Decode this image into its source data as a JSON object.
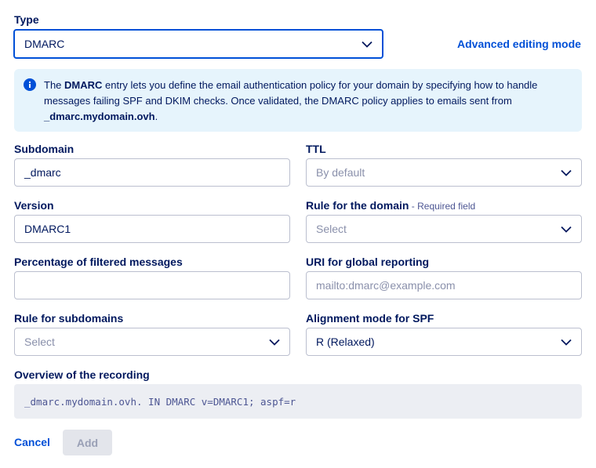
{
  "type": {
    "label": "Type",
    "value": "DMARC"
  },
  "advanced_link": "Advanced editing mode",
  "info": {
    "p1": "The ",
    "bold1": "DMARC",
    "p2": " entry lets you define the email authentication policy for your domain by specifying how to handle messages failing SPF and DKIM checks. Once validated, the DMARC policy applies to emails sent from ",
    "bold2": "_dmarc.mydomain.ovh",
    "p3": "."
  },
  "subdomain": {
    "label": "Subdomain",
    "value": "_dmarc"
  },
  "ttl": {
    "label": "TTL",
    "placeholder": "By default"
  },
  "version": {
    "label": "Version",
    "value": "DMARC1"
  },
  "rule_domain": {
    "label": "Rule for the domain",
    "hint": " - Required field",
    "placeholder": "Select"
  },
  "percentage": {
    "label": "Percentage of filtered messages",
    "value": ""
  },
  "uri_global": {
    "label": "URI for global reporting",
    "placeholder": "mailto:dmarc@example.com"
  },
  "rule_subdomains": {
    "label": "Rule for subdomains",
    "placeholder": "Select"
  },
  "alignment_spf": {
    "label": "Alignment mode for SPF",
    "value": "R (Relaxed)"
  },
  "overview": {
    "label": "Overview of the recording",
    "value": "_dmarc.mydomain.ovh. IN DMARC v=DMARC1; aspf=r"
  },
  "actions": {
    "cancel": "Cancel",
    "add": "Add"
  },
  "colors": {
    "primary": "#0050d7",
    "text": "#00185e",
    "info_bg": "#e6f4fc"
  },
  "icons": {
    "info": "info-icon",
    "chevron": "chevron-down-icon"
  }
}
